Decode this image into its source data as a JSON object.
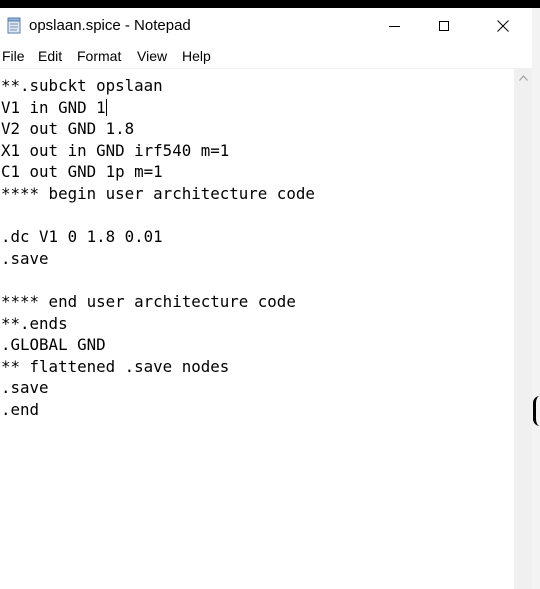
{
  "window": {
    "title": "opslaan.spice - Notepad"
  },
  "icons": {
    "app": "notepad-icon",
    "minimize": "minimize-icon",
    "maximize": "maximize-icon",
    "close": "close-icon",
    "scroll_up": "chevron-up-icon"
  },
  "menu": {
    "items": [
      "File",
      "Edit",
      "Format",
      "View",
      "Help"
    ]
  },
  "editor": {
    "lines": [
      "**.subckt opslaan",
      "V1 in GND 1",
      "V2 out GND 1.8",
      "X1 out in GND irf540 m=1",
      "C1 out GND 1p m=1",
      "**** begin user architecture code",
      "",
      ".dc V1 0 1.8 0.01",
      ".save",
      "",
      "**** end user architecture code",
      "**.ends",
      ".GLOBAL GND",
      "** flattened .save nodes",
      ".save",
      ".end"
    ],
    "caret_line": 2
  }
}
